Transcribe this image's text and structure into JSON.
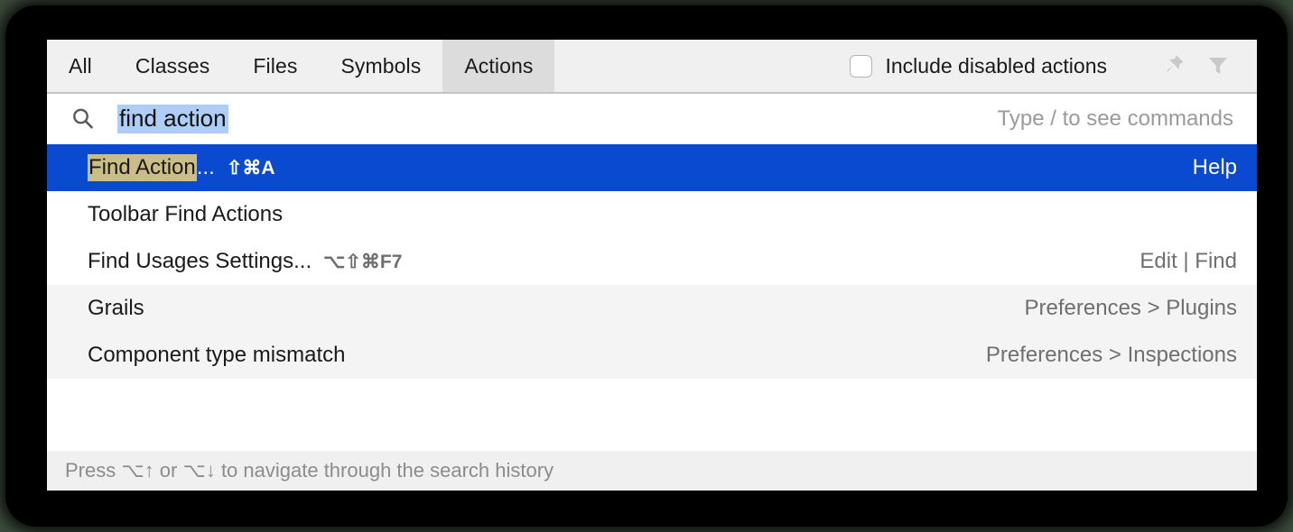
{
  "window": {
    "backdrop_color": "#3b4a3b",
    "plate_color": "#000000"
  },
  "tabs": [
    {
      "label": "All",
      "active": false
    },
    {
      "label": "Classes",
      "active": false
    },
    {
      "label": "Files",
      "active": false
    },
    {
      "label": "Symbols",
      "active": false
    },
    {
      "label": "Actions",
      "active": true
    }
  ],
  "toolbar": {
    "include_disabled_label": "Include disabled actions",
    "include_disabled_checked": false,
    "pin_icon": "pin-icon",
    "filter_icon": "filter-icon",
    "icon_color": "#c8c8c8"
  },
  "search": {
    "icon": "search-icon",
    "value": "find action",
    "selection_color": "#aecdf7",
    "hint": "Type / to see commands"
  },
  "results": {
    "selection_color": "#0a4ad1",
    "match_highlight_color": "#cbbd87",
    "items": [
      {
        "match_prefix": "Find Action",
        "text_suffix": "...",
        "shortcut": "⇧⌘A",
        "right": "Help",
        "selected": true,
        "shaded": false
      },
      {
        "match_prefix": "",
        "text_suffix": "Toolbar Find Actions",
        "shortcut": "",
        "right": "",
        "selected": false,
        "shaded": false
      },
      {
        "match_prefix": "",
        "text_suffix": "Find Usages Settings...",
        "shortcut": "⌥⇧⌘F7",
        "right": "Edit | Find",
        "selected": false,
        "shaded": false
      },
      {
        "match_prefix": "",
        "text_suffix": "Grails",
        "shortcut": "",
        "right": "Preferences > Plugins",
        "selected": false,
        "shaded": true
      },
      {
        "match_prefix": "",
        "text_suffix": "Component type mismatch",
        "shortcut": "",
        "right": "Preferences > Inspections",
        "selected": false,
        "shaded": true
      }
    ]
  },
  "footer": {
    "hint": "Press ⌥↑ or ⌥↓ to navigate through the search history"
  }
}
